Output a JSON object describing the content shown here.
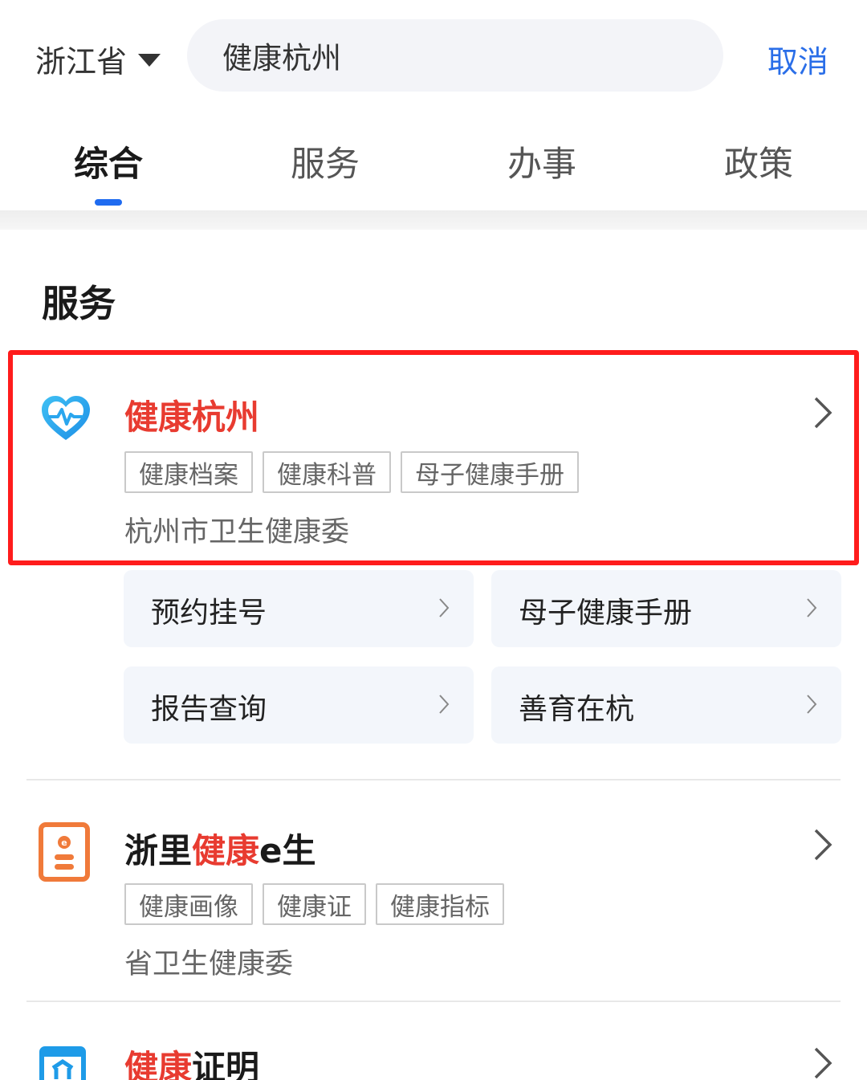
{
  "header": {
    "province": "浙江省",
    "search_value": "健康杭州",
    "cancel_label": "取消"
  },
  "tabs": [
    {
      "label": "综合",
      "active": true
    },
    {
      "label": "服务",
      "active": false
    },
    {
      "label": "办事",
      "active": false
    },
    {
      "label": "政策",
      "active": false
    }
  ],
  "section_title": "服务",
  "results": [
    {
      "icon": "heartbeat-icon",
      "title_highlight": "健康杭州",
      "title_rest": "",
      "tags": [
        "健康档案",
        "健康科普",
        "母子健康手册"
      ],
      "provider": "杭州市卫生健康委",
      "services": [
        "预约挂号",
        "母子健康手册",
        "报告查询",
        "善育在杭"
      ]
    },
    {
      "icon": "health-card-icon",
      "title_prefix": "浙里",
      "title_highlight": "健康",
      "title_rest": "e生",
      "tags": [
        "健康画像",
        "健康证",
        "健康指标"
      ],
      "provider": "省卫生健康委"
    },
    {
      "icon": "certificate-icon",
      "title_highlight": "健康",
      "title_rest": "证明"
    }
  ],
  "colors": {
    "accent": "#2a6ee8",
    "highlight_text": "#e83b30",
    "tab_indicator": "#1f6bf0",
    "annotation_box": "#ff1c1c"
  }
}
